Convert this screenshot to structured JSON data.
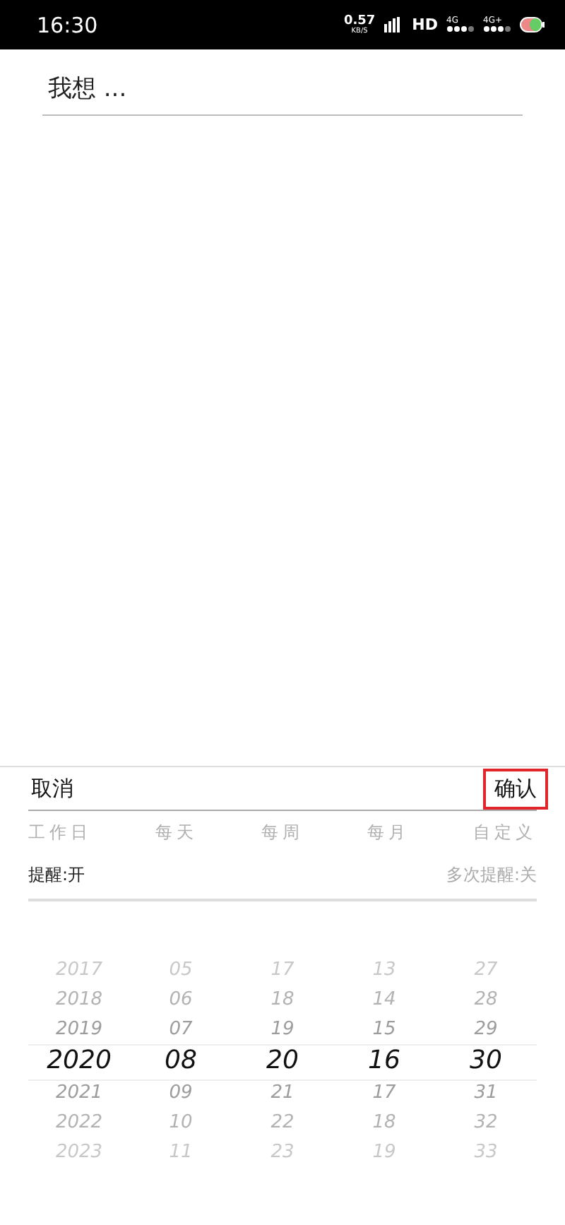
{
  "status_bar": {
    "time": "16:30",
    "speed": "0.57",
    "speed_unit": "KB/S",
    "hd": "HD",
    "networks": [
      "4G",
      "4G+"
    ]
  },
  "input": {
    "placeholder": "我想 ..."
  },
  "sheet": {
    "cancel": "取消",
    "confirm": "确认",
    "repeat_options": [
      "工作日",
      "每天",
      "每周",
      "每月",
      "自定义"
    ],
    "reminder": "提醒:开",
    "multi_reminder": "多次提醒:关",
    "picker": {
      "columns": [
        {
          "items": [
            {
              "text": "2017",
              "selected": false
            },
            {
              "text": "2018",
              "selected": false
            },
            {
              "text": "2019",
              "selected": false
            },
            {
              "text": "2020",
              "selected": true
            },
            {
              "text": "2021",
              "selected": false
            },
            {
              "text": "2022",
              "selected": false
            },
            {
              "text": "2023",
              "selected": false
            }
          ]
        },
        {
          "items": [
            {
              "text": "05",
              "selected": false
            },
            {
              "text": "06",
              "selected": false
            },
            {
              "text": "07",
              "selected": false
            },
            {
              "text": "08",
              "selected": true
            },
            {
              "text": "09",
              "selected": false
            },
            {
              "text": "10",
              "selected": false
            },
            {
              "text": "11",
              "selected": false
            }
          ]
        },
        {
          "items": [
            {
              "text": "17",
              "selected": false
            },
            {
              "text": "18",
              "selected": false
            },
            {
              "text": "19",
              "selected": false
            },
            {
              "text": "20",
              "selected": true
            },
            {
              "text": "21",
              "selected": false
            },
            {
              "text": "22",
              "selected": false
            },
            {
              "text": "23",
              "selected": false
            }
          ]
        },
        {
          "items": [
            {
              "text": "13",
              "selected": false
            },
            {
              "text": "14",
              "selected": false
            },
            {
              "text": "15",
              "selected": false
            },
            {
              "text": "16",
              "selected": true
            },
            {
              "text": "17",
              "selected": false
            },
            {
              "text": "18",
              "selected": false
            },
            {
              "text": "19",
              "selected": false
            }
          ]
        },
        {
          "items": [
            {
              "text": "27",
              "selected": false
            },
            {
              "text": "28",
              "selected": false
            },
            {
              "text": "29",
              "selected": false
            },
            {
              "text": "30",
              "selected": true
            },
            {
              "text": "31",
              "selected": false
            },
            {
              "text": "32",
              "selected": false
            },
            {
              "text": "33",
              "selected": false
            }
          ]
        }
      ]
    }
  }
}
